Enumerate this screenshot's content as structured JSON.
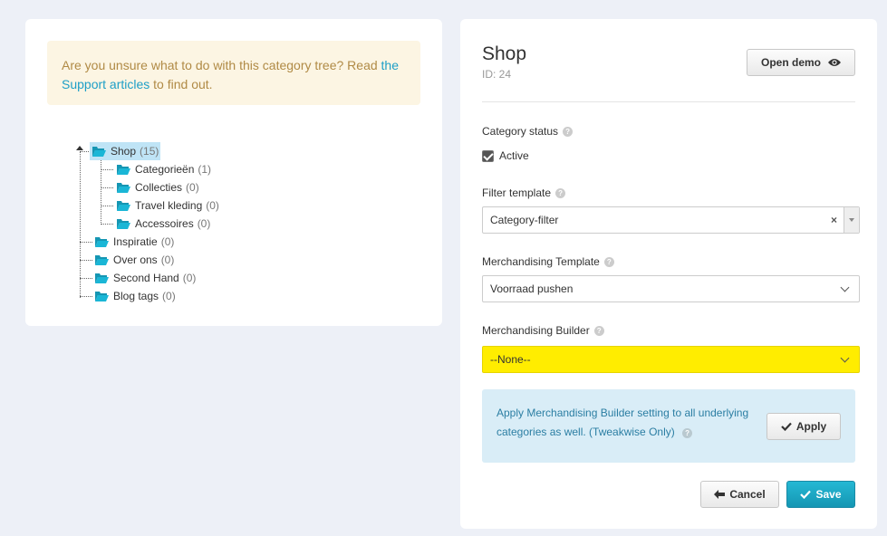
{
  "left_panel": {
    "notice": {
      "text_before": "Are you unsure what to do with this category tree? Read",
      "link_text": "the Support articles",
      "text_after": "to find out."
    },
    "tree": {
      "root": {
        "label": "Shop",
        "count": "(15)"
      },
      "children": [
        {
          "label": "Categorieën",
          "count": "(1)"
        },
        {
          "label": "Collecties",
          "count": "(0)"
        },
        {
          "label": "Travel kleding",
          "count": "(0)"
        },
        {
          "label": "Accessoires",
          "count": "(0)"
        }
      ],
      "siblings": [
        {
          "label": "Inspiratie",
          "count": "(0)"
        },
        {
          "label": "Over ons",
          "count": "(0)"
        },
        {
          "label": "Second Hand",
          "count": "(0)"
        },
        {
          "label": "Blog tags",
          "count": "(0)"
        }
      ]
    }
  },
  "right_panel": {
    "title": "Shop",
    "id_text": "ID: 24",
    "open_demo_label": "Open demo",
    "category_status": {
      "label": "Category status",
      "checkbox_label": "Active",
      "checked": true
    },
    "filter_template": {
      "label": "Filter template",
      "value": "Category-filter"
    },
    "merch_template": {
      "label": "Merchandising Template",
      "value": "Voorraad pushen"
    },
    "merch_builder": {
      "label": "Merchandising Builder",
      "value": "--None--"
    },
    "info": {
      "text": "Apply Merchandising Builder setting to all underlying categories as well. (Tweakwise Only)",
      "apply_label": "Apply"
    },
    "cancel_label": "Cancel",
    "save_label": "Save"
  },
  "colors": {
    "accent": "#1d9fc7",
    "highlight": "#ffed00",
    "folder": "#1ab6d6"
  }
}
